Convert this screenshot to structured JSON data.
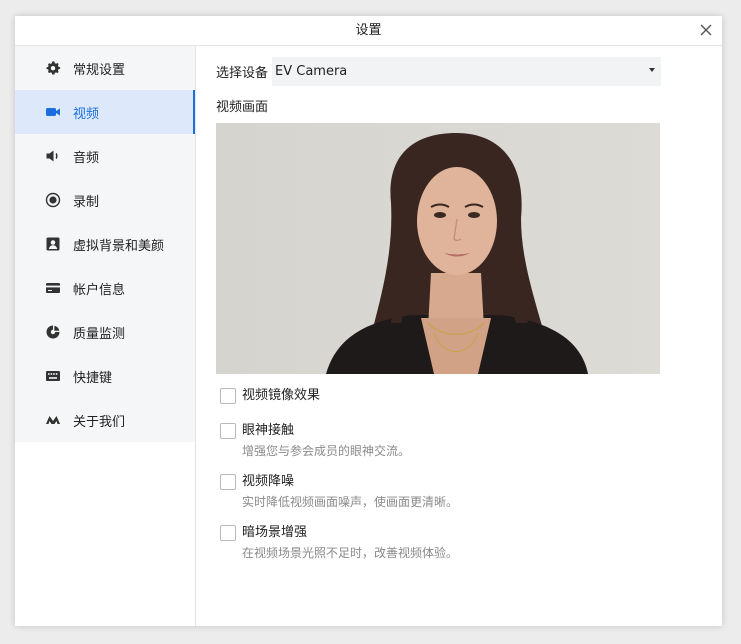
{
  "window": {
    "title": "设置"
  },
  "sidebar": {
    "items": [
      {
        "label": "常规设置",
        "icon": "gear-icon"
      },
      {
        "label": "视频",
        "icon": "video-camera-icon",
        "active": true
      },
      {
        "label": "音频",
        "icon": "speaker-icon"
      },
      {
        "label": "录制",
        "icon": "record-icon"
      },
      {
        "label": "虚拟背景和美颜",
        "icon": "portrait-icon"
      },
      {
        "label": "帐户信息",
        "icon": "card-icon"
      },
      {
        "label": "质量监测",
        "icon": "monitor-icon"
      },
      {
        "label": "快捷键",
        "icon": "keyboard-icon"
      },
      {
        "label": "关于我们",
        "icon": "logo-icon"
      }
    ]
  },
  "main": {
    "device_label": "选择设备",
    "device_value": "EV Camera",
    "preview_label": "视频画面",
    "options": [
      {
        "title": "视频镜像效果",
        "desc": "",
        "checked": false
      },
      {
        "title": "眼神接触",
        "desc": "增强您与参会成员的眼神交流。",
        "checked": false
      },
      {
        "title": "视频降噪",
        "desc": "实时降低视频画面噪声，使画面更清晰。",
        "checked": false
      },
      {
        "title": "暗场景增强",
        "desc": "在视频场景光照不足时，改善视频体验。",
        "checked": false
      }
    ]
  },
  "colors": {
    "accent": "#1a6fe0",
    "active_bg": "#dde9fb",
    "sidebar_bg": "#f5f6f8"
  }
}
